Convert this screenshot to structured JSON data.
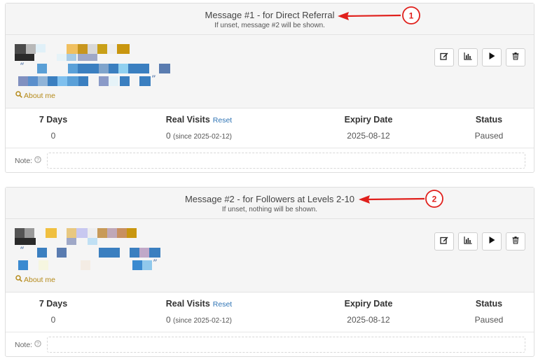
{
  "messages": [
    {
      "title": "Message #1 - for Direct Referral",
      "subtitle": "If unset, message #2 will be shown.",
      "about_label": "About me",
      "stats": {
        "days_header": "7 Days",
        "days_value": "0",
        "visits_header": "Real Visits",
        "reset_label": "Reset",
        "visits_value": "0",
        "visits_since": "(since 2025-02-12)",
        "expiry_header": "Expiry Date",
        "expiry_value": "2025-08-12",
        "status_header": "Status",
        "status_value": "Paused"
      },
      "note_label": "Note:",
      "annotation_number": "1"
    },
    {
      "title": "Message #2 - for Followers at Levels 2-10",
      "subtitle": "If unset, nothing will be shown.",
      "about_label": "About me",
      "stats": {
        "days_header": "7 Days",
        "days_value": "0",
        "visits_header": "Real Visits",
        "reset_label": "Reset",
        "visits_value": "0",
        "visits_since": "(since 2025-02-12)",
        "expiry_header": "Expiry Date",
        "expiry_value": "2025-08-12",
        "status_header": "Status",
        "status_value": "Paused"
      },
      "note_label": "Note:",
      "annotation_number": "2"
    }
  ],
  "icons": {
    "edit": "edit-icon",
    "stats": "bar-chart-icon",
    "play": "play-icon",
    "delete": "trash-icon",
    "search": "search-icon",
    "help": "help-circle-icon"
  },
  "colors": {
    "annotation_red": "#e0201c",
    "link_blue": "#2f74b5",
    "about_gold": "#b58a1a"
  }
}
